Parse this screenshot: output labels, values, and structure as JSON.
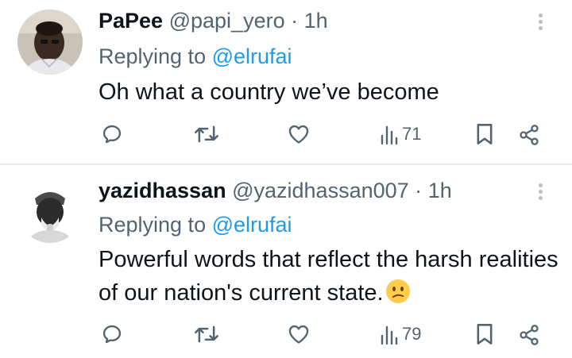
{
  "tweets": [
    {
      "name": "PaPee",
      "handle": "@papi_yero",
      "dot": "·",
      "time": "1h",
      "replying_prefix": "Replying to ",
      "replying_to": "@elrufai",
      "text": "Oh what a country we’ve become",
      "emoji": "",
      "views": "71"
    },
    {
      "name": "yazidhassan",
      "handle": "@yazidhassan007",
      "dot": "·",
      "time": "1h",
      "replying_prefix": "Replying to ",
      "replying_to": "@elrufai",
      "text": "Powerful words that reflect the harsh realities of our nation's current state.",
      "emoji": "confused-face-emoji",
      "views": "79"
    }
  ],
  "colors": {
    "text": "#0f1419",
    "secondary": "#536471",
    "link": "#1d9bf0",
    "divider": "#e6ecf0"
  },
  "icons": [
    "reply-icon",
    "retweet-icon",
    "like-icon",
    "views-icon",
    "bookmark-icon",
    "share-icon",
    "more-icon"
  ]
}
